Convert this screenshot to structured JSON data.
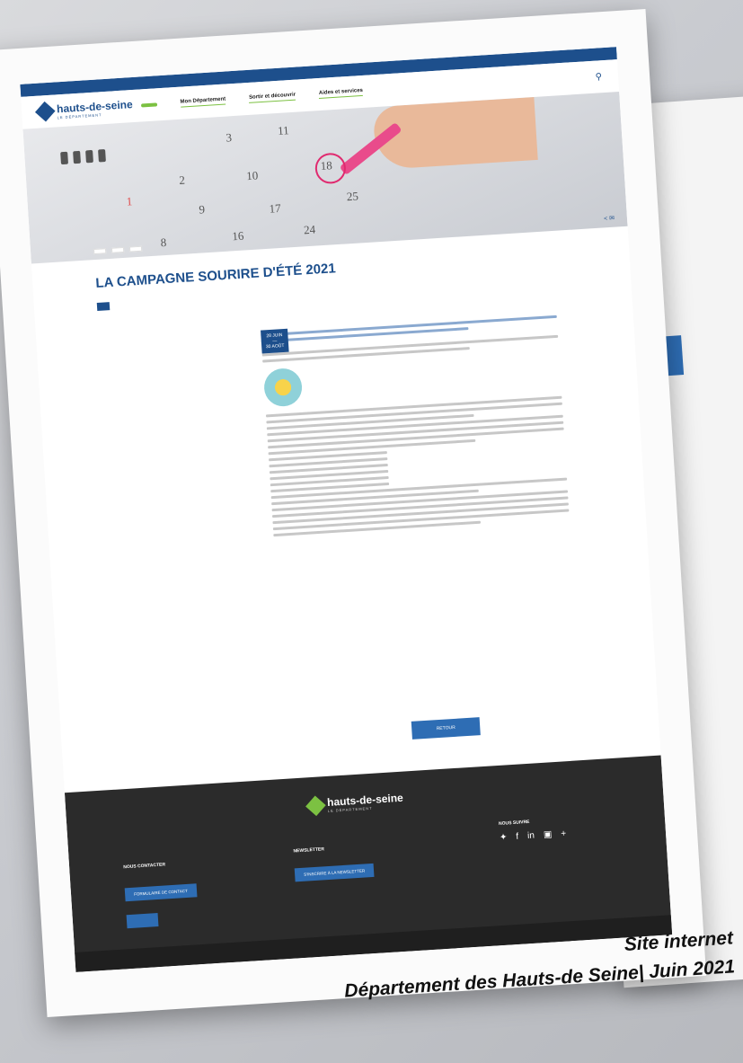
{
  "header": {
    "logo_name": "hauts-de-seine",
    "logo_sub": "LE DÉPARTEMENT",
    "nav": [
      "Mon Département",
      "Sortir et découvrir",
      "Aides et services"
    ]
  },
  "article": {
    "title": "LA CAMPAGNE SOURIRE D'ÉTÉ 2021",
    "date_from": "28 JUIN",
    "date_to": "30 AOÛT",
    "sun_label": "Sourire d'été",
    "back_button": "RETOUR"
  },
  "footer": {
    "logo_name": "hauts-de-seine",
    "logo_sub": "LE DÉPARTEMENT",
    "contact_title": "NOUS CONTACTER",
    "contact_button": "FORMULAIRE DE CONTACT",
    "newsletter_title": "NEWSLETTER",
    "newsletter_button": "S'INSCRIRE À LA NEWSLETTER",
    "follow_title": "NOUS SUIVRE"
  },
  "caption": {
    "line1": "Site internet",
    "line2": "Département des Hauts-de Seine| Juin 2021"
  }
}
